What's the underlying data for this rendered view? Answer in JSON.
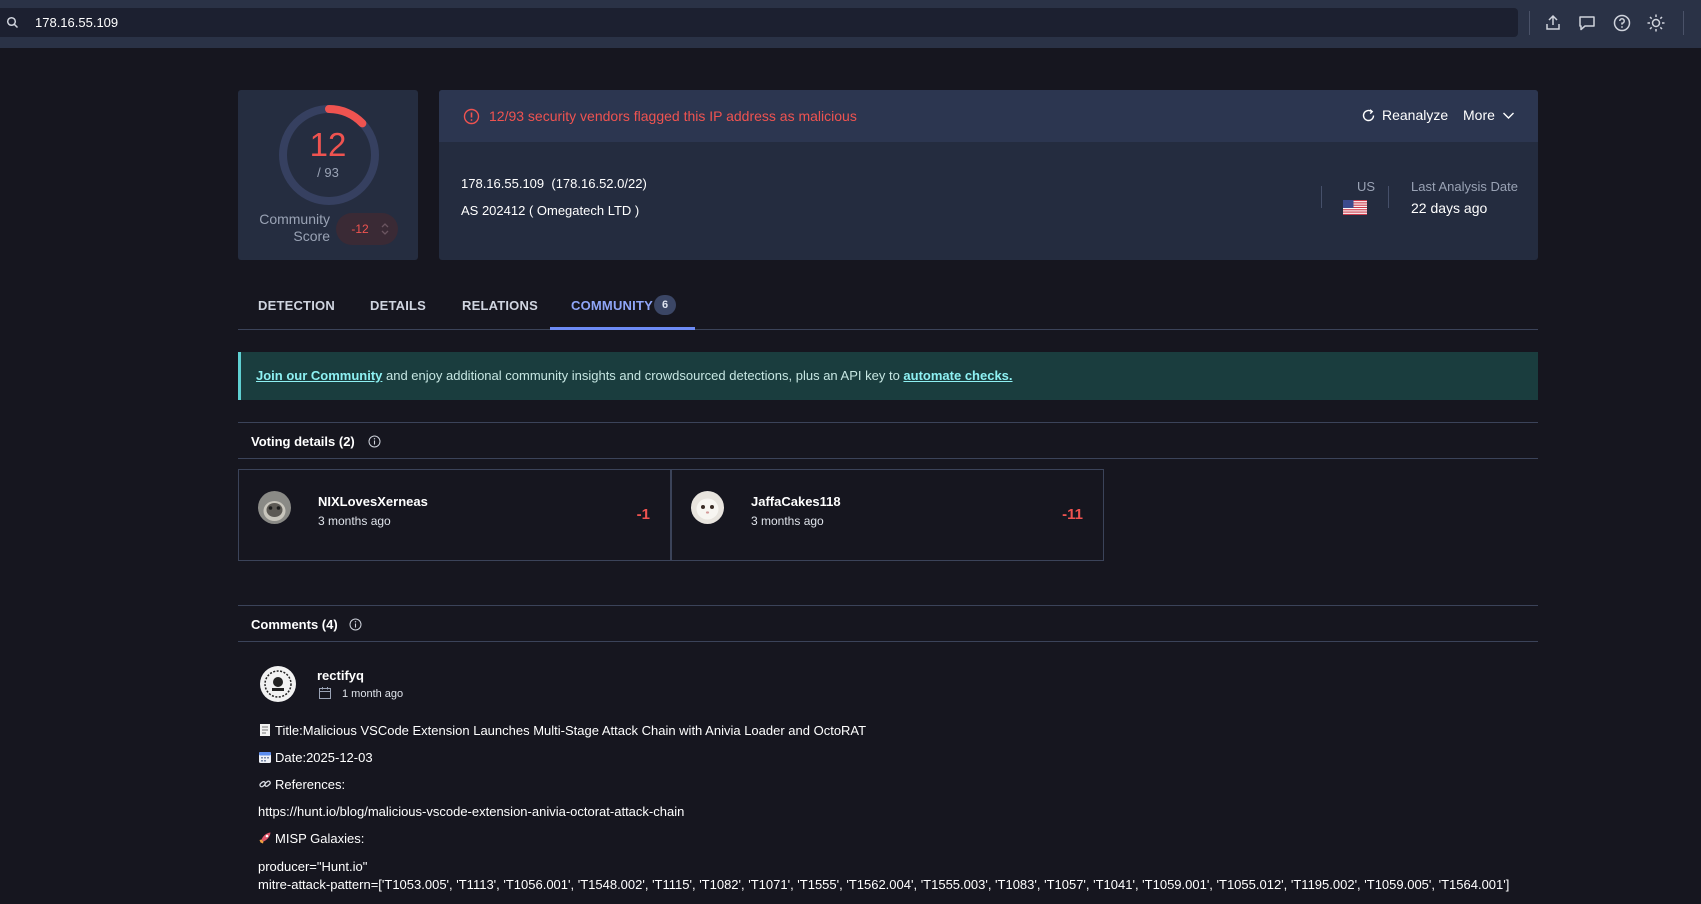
{
  "search": {
    "value": "178.16.55.109"
  },
  "score": {
    "detections": "12",
    "total": "/ 93",
    "detections_fraction": 0.129,
    "community_label_1": "Community",
    "community_label_2": "Score",
    "community_value": "-12"
  },
  "alert": {
    "text": "12/93 security vendors flagged this IP address as malicious",
    "reanalyze_label": "Reanalyze",
    "more_label": "More"
  },
  "ip": {
    "address": "178.16.55.109",
    "range": "(178.16.52.0/22)",
    "as_line": "AS 202412  ( Omegatech LTD )",
    "country": "US",
    "last_analysis_label": "Last Analysis Date",
    "last_analysis_value": "22 days ago"
  },
  "tabs": [
    {
      "label": "DETECTION"
    },
    {
      "label": "DETAILS"
    },
    {
      "label": "RELATIONS"
    },
    {
      "label": "COMMUNITY",
      "count": "6"
    }
  ],
  "banner": {
    "link1": "Join our Community",
    "middle": " and enjoy additional community insights and crowdsourced detections, plus an API key to ",
    "link2": "automate checks."
  },
  "voting": {
    "title": "Voting details  (2)",
    "votes": [
      {
        "user": "NIXLovesXerneas",
        "time": "3 months ago",
        "score": "-1"
      },
      {
        "user": "JaffaCakes118",
        "time": "3 months ago",
        "score": "-11"
      }
    ]
  },
  "comments": {
    "title": "Comments  (4)",
    "items": [
      {
        "user": "rectifyq",
        "time": "1 month ago",
        "title_line": "Title:Malicious VSCode Extension Launches Multi-Stage Attack Chain with Anivia Loader and OctoRAT",
        "date_line": "Date:2025-12-03",
        "references_label": "References:",
        "reference_url": "https://hunt.io/blog/malicious-vscode-extension-anivia-octorat-attack-chain",
        "misp_label": "MISP Galaxies:",
        "producer": "producer=\"Hunt.io\"",
        "mitre": "mitre-attack-pattern=['T1053.005', 'T1113', 'T1056.001', 'T1548.002', 'T1115', 'T1082', 'T1071', 'T1555', 'T1562.004', 'T1555.003', 'T1083', 'T1057', 'T1041', 'T1059.001', 'T1055.012', 'T1195.002', 'T1059.005', 'T1564.001']"
      }
    ]
  },
  "colors": {
    "malicious": "#ef5350",
    "accent": "#6d8bf5",
    "banner_bg": "#1a3d3e"
  }
}
